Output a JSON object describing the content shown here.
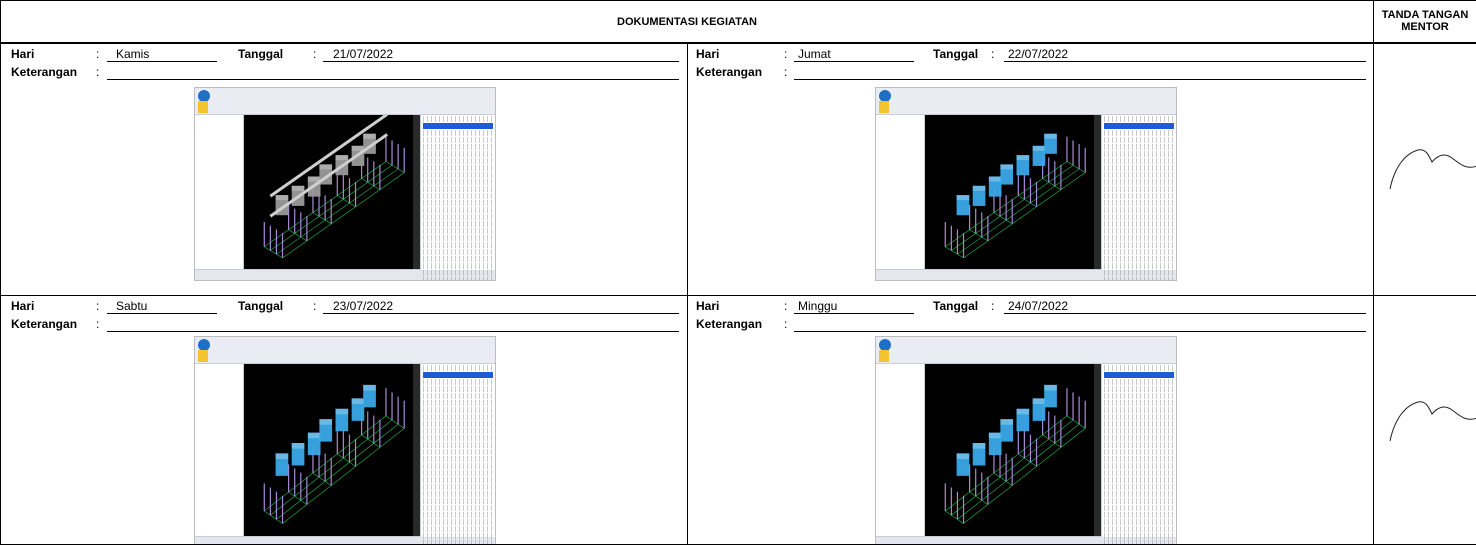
{
  "header": {
    "title": "DOKUMENTASI KEGIATAN",
    "sign_line1": "TANDA TANGAN",
    "sign_line2": "MENTOR"
  },
  "labels": {
    "hari": "Hari",
    "keterangan": "Keterangan",
    "tanggal": "Tanggal",
    "colon": ":"
  },
  "entries": [
    {
      "hari": "Kamis",
      "tanggal": "21/07/2022",
      "keterangan": ""
    },
    {
      "hari": "Jumat",
      "tanggal": "22/07/2022",
      "keterangan": ""
    },
    {
      "hari": "Sabtu",
      "tanggal": "23/07/2022",
      "keterangan": ""
    },
    {
      "hari": "Minggu",
      "tanggal": "24/07/2022",
      "keterangan": ""
    }
  ],
  "colors": {
    "model_blue": "#3aa9e8",
    "model_gray": "#9a9a9a",
    "grid_green": "#19c24a",
    "column_purple": "#a98bd6",
    "highlight_blue": "#1e5bd6"
  }
}
